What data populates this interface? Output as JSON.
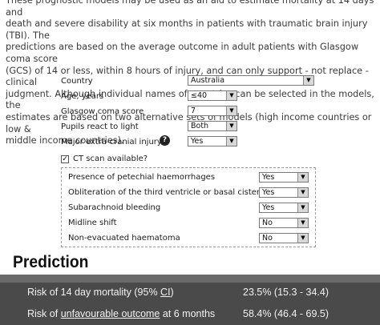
{
  "intro": {
    "line1": "These prognostic models may be used as an aid to estimate mortality at 14 days and",
    "line2": "death and severe disability at six months in patients with traumatic brain injury (TBI). The",
    "line3": "predictions are based on the average outcome in adult patients with Glasgow coma score",
    "line4": "(GCS) of 14 or less, within 8 hours of injury, and can only support - not replace - clinical",
    "line5": "judgment. Although individual names of countries can be selected in the models, the",
    "line6": "estimates are based on two alternative sets of models (high income countries or low &",
    "line7": "middle income countries)."
  },
  "form": {
    "country": {
      "label": "Country",
      "value": "Australia"
    },
    "age": {
      "label": "Age, years",
      "value": "≤40"
    },
    "gcs": {
      "label": "Glasgow coma score",
      "value": "7"
    },
    "pupils": {
      "label": "Pupils react to light",
      "value": "Both"
    },
    "extracranial": {
      "label": "Major extra-cranial injury?",
      "value": "Yes"
    },
    "ct_scan": {
      "label": "CT scan available?",
      "checked": "✓"
    }
  },
  "ct": {
    "petechial": {
      "label": "Presence of petechial haemorrhages",
      "value": "Yes"
    },
    "obliteration": {
      "label": "Obliteration of the third ventricle or basal cisterns",
      "value": "Yes"
    },
    "sah": {
      "label": "Subarachnoid bleeding",
      "value": "Yes"
    },
    "midline": {
      "label": "Midline shift",
      "value": "No"
    },
    "haematoma": {
      "label": "Non-evacuated haematoma",
      "value": "No"
    }
  },
  "prediction": {
    "title": "Prediction",
    "mortality_prefix": "Risk of 14 day mortality (95% ",
    "mortality_ci": "CI",
    "mortality_suffix": ")",
    "mortality_value": "23.5% (15.3 - 34.4)",
    "outcome_prefix": "Risk of ",
    "outcome_link": "unfavourable outcome",
    "outcome_suffix": " at 6 months",
    "outcome_value": "58.4% (46.4 - 69.5)"
  },
  "icons": {
    "help": "help-icon",
    "arrow": "▼"
  }
}
